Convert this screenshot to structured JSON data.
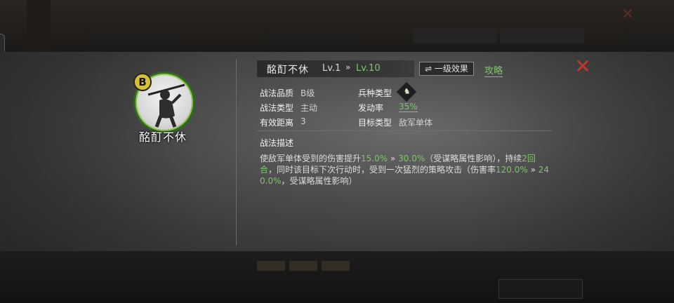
{
  "skill": {
    "name": "酩酊不休",
    "grade": "B",
    "level_current": "Lv.1",
    "level_arrow": "»",
    "level_max": "Lv.10",
    "effect_button": "⇌ 一级效果",
    "strategy_link": "攻略",
    "close_icon": "close-icon"
  },
  "attributes": {
    "quality_label": "战法品质",
    "quality_value": "B级",
    "type_label": "战法类型",
    "type_value": "主动",
    "range_label": "有效距离",
    "range_value": "3",
    "unit_label": "兵种类型",
    "unit_icon": "horse-icon",
    "rate_label": "发动率",
    "rate_value": "35%",
    "target_label": "目标类型",
    "target_value": "敌军单体"
  },
  "description": {
    "title": "战法描述",
    "p1": "使敌军单体受到的伤害提升",
    "v1": "15.0%",
    "a1": " » ",
    "v2": "30.0%",
    "p2": "（受谋略属性影响），持续",
    "v3": "2回合",
    "p3": "，同时该目标下次行动时，受到一次猛烈的策略攻击（伤害率",
    "v4": "120.0%",
    "a2": " » ",
    "v5": "240.0%",
    "p4": "，受谋略属性影响）"
  },
  "colors": {
    "accent_green": "#7dc56b",
    "close_red": "#c0392b",
    "grade_gold": "#d8c03a"
  }
}
